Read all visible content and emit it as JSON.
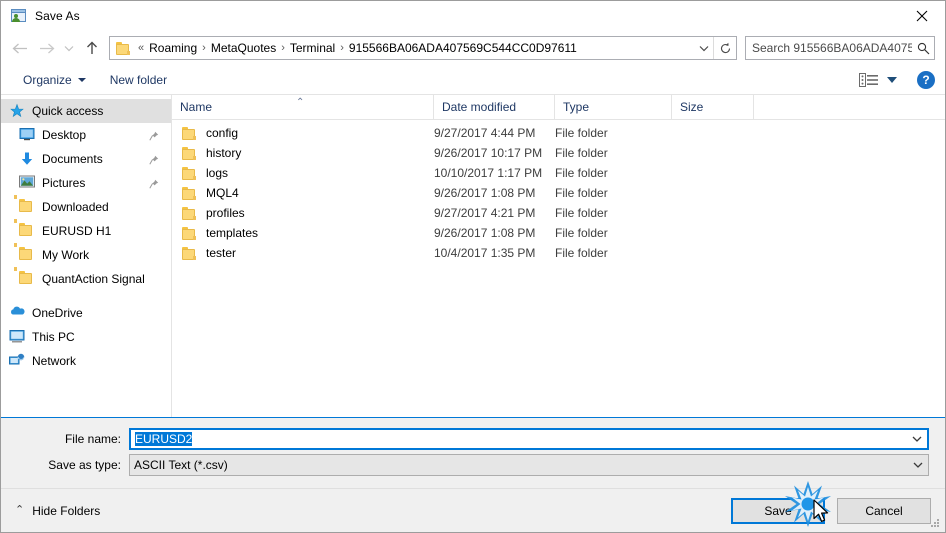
{
  "window": {
    "title": "Save As",
    "title_icon": "save-as-app-icon",
    "close_icon": "close-icon"
  },
  "nav": {
    "back_icon": "back-arrow-icon",
    "forward_icon": "forward-arrow-icon",
    "history_icon": "chevron-down-icon",
    "up_icon": "up-arrow-icon",
    "address_folder_icon": "folder-icon",
    "breadcrumbs": [
      "Roaming",
      "MetaQuotes",
      "Terminal",
      "915566BA06ADA407569C544CC0D97611"
    ],
    "breadcrumb_prefix": "«",
    "breadcrumb_separator": "›",
    "address_dropdown_icon": "chevron-down-icon",
    "refresh_icon": "refresh-icon"
  },
  "search": {
    "placeholder": "Search 915566BA06ADA40756...",
    "icon": "search-icon"
  },
  "toolbar": {
    "organize_label": "Organize",
    "new_folder_label": "New folder",
    "view_icon": "view-layout-icon",
    "view_caret_icon": "chevron-down-icon",
    "help_label": "?",
    "help_icon": "help-icon"
  },
  "sidebar": {
    "items": [
      {
        "label": "Quick access",
        "icon": "star-pin-icon",
        "selected": true,
        "group": true,
        "pinned": false
      },
      {
        "label": "Desktop",
        "icon": "desktop-icon",
        "selected": false,
        "group": false,
        "pinned": true
      },
      {
        "label": "Documents",
        "icon": "documents-download-icon",
        "selected": false,
        "group": false,
        "pinned": true
      },
      {
        "label": "Pictures",
        "icon": "pictures-icon",
        "selected": false,
        "group": false,
        "pinned": true
      },
      {
        "label": "Downloaded",
        "icon": "folder-icon",
        "selected": false,
        "group": false,
        "pinned": false
      },
      {
        "label": "EURUSD H1",
        "icon": "folder-icon",
        "selected": false,
        "group": false,
        "pinned": false
      },
      {
        "label": "My Work",
        "icon": "folder-icon",
        "selected": false,
        "group": false,
        "pinned": false
      },
      {
        "label": "QuantAction Signal",
        "icon": "folder-icon",
        "selected": false,
        "group": false,
        "pinned": false
      }
    ],
    "groups": [
      {
        "label": "OneDrive",
        "icon": "onedrive-cloud-icon"
      },
      {
        "label": "This PC",
        "icon": "this-pc-icon"
      },
      {
        "label": "Network",
        "icon": "network-icon"
      }
    ]
  },
  "filelist": {
    "columns": [
      "Name",
      "Date modified",
      "Type",
      "Size"
    ],
    "sort_indicator": "⌃",
    "rows": [
      {
        "name": "config",
        "date": "9/27/2017 4:44 PM",
        "type": "File folder",
        "size": ""
      },
      {
        "name": "history",
        "date": "9/26/2017 10:17 PM",
        "type": "File folder",
        "size": ""
      },
      {
        "name": "logs",
        "date": "10/10/2017 1:17 PM",
        "type": "File folder",
        "size": ""
      },
      {
        "name": "MQL4",
        "date": "9/26/2017 1:08 PM",
        "type": "File folder",
        "size": ""
      },
      {
        "name": "profiles",
        "date": "9/27/2017 4:21 PM",
        "type": "File folder",
        "size": ""
      },
      {
        "name": "templates",
        "date": "9/26/2017 1:08 PM",
        "type": "File folder",
        "size": ""
      },
      {
        "name": "tester",
        "date": "10/4/2017 1:35 PM",
        "type": "File folder",
        "size": ""
      }
    ]
  },
  "form": {
    "filename_label": "File name:",
    "filename_value": "EURUSD2",
    "filetype_label": "Save as type:",
    "filetype_value": "ASCII Text (*.csv)",
    "dropdown_icon": "chevron-down-icon"
  },
  "footer": {
    "hide_folders_label": "Hide Folders",
    "hide_folders_caret": "⌃",
    "save_label": "Save",
    "cancel_label": "Cancel",
    "resize_grip_icon": "resize-grip-icon",
    "cursor_icon": "mouse-pointer-icon",
    "click_burst_icon": "click-burst-icon"
  },
  "colors": {
    "accent": "#0078d7",
    "header_text": "#1f3864",
    "folder_yellow": "#fcd878",
    "panel_bg": "#f0f0f0"
  }
}
